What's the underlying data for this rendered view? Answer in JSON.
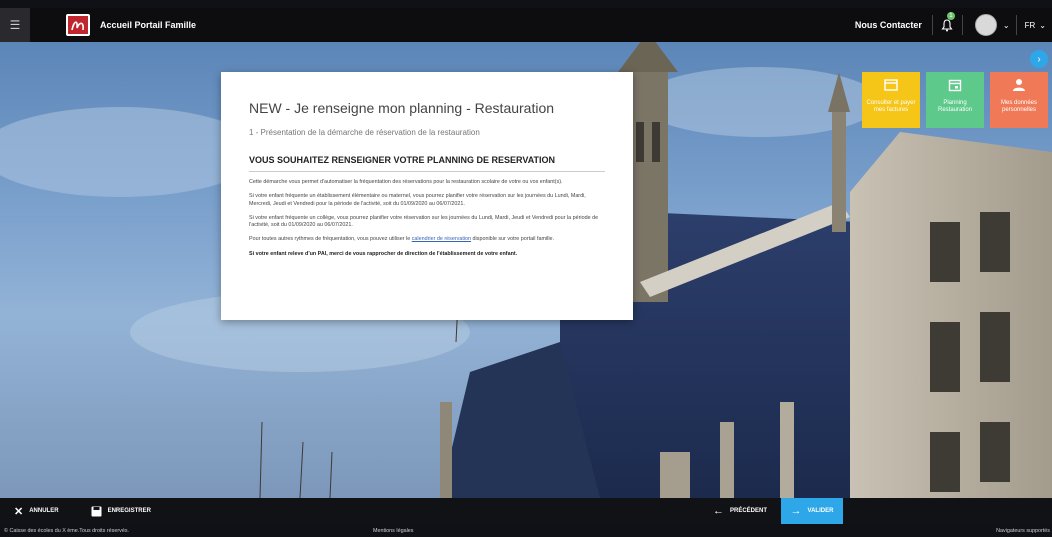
{
  "header": {
    "title": "Accueil Portail Famille",
    "contact": "Nous Contacter",
    "notifications": "1",
    "language": "FR"
  },
  "tiles": [
    {
      "label": "Consulter et payer mes factures",
      "color": "#f5c518",
      "icon": "invoice-icon"
    },
    {
      "label": "Planning Restauration",
      "color": "#5dc98a",
      "icon": "calendar-icon"
    },
    {
      "label": "Mes données personnelles",
      "color": "#f07a58",
      "icon": "user-icon"
    }
  ],
  "card": {
    "title": "NEW - Je renseigne mon planning - Restauration",
    "subtitle": "1 - Présentation de la démarche de réservation de la restauration",
    "heading": "VOUS SOUHAITEZ RENSEIGNER VOTRE PLANNING DE RESERVATION",
    "p1": "Cette démarche vous permet d'automatiser la fréquentation des réservations pour la restauration scolaire de votre ou vos enfant(s).",
    "p2": "Si votre enfant fréquente un établissement élémentaire ou maternel, vous pourrez planifier votre réservation sur les journées du Lundi, Mardi, Mercredi, Jeudi et Vendredi pour la période de l'activité, soit du 01/09/2020 au 06/07/2021.",
    "p3": "Si votre enfant fréquente un collège, vous pourrez planifier votre réservation sur les journées du Lundi, Mardi, Jeudi et Vendredi pour la période de l'activité, soit du 01/09/2020 au 06/07/2021.",
    "p4_before": "Pour toutes autres rythmes de fréquentation, vous pouvez utiliser le ",
    "p4_link": "calendrier de réservation",
    "p4_after": " disponible sur votre portail famille.",
    "p5": "Si votre enfant releve d'un PAI, merci de vous rapprocher de direction de l'établissement de votre enfant."
  },
  "actions": {
    "cancel": "ANNULER",
    "save": "ENREGISTRER",
    "previous": "PRÉCÉDENT",
    "validate": "VALIDER"
  },
  "footer": {
    "copyright": "© Caisse des écoles du X ème.Tous droits réservés.",
    "legal": "Mentions légales",
    "browsers": "Navigateurs supportés"
  }
}
